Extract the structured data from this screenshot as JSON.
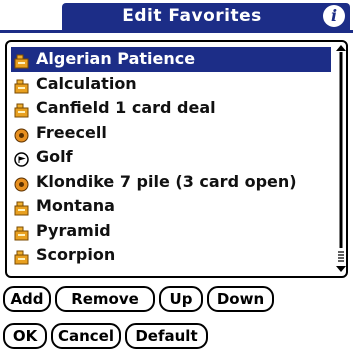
{
  "title": "Edit Favorites",
  "info_glyph": "i",
  "accent_color": "#1c2d87",
  "favorites": [
    {
      "label": "Algerian Patience",
      "icon": "briefcase-icon",
      "selected": true
    },
    {
      "label": "Calculation",
      "icon": "briefcase-icon",
      "selected": false
    },
    {
      "label": "Canfield 1 card deal",
      "icon": "briefcase-icon",
      "selected": false
    },
    {
      "label": "Freecell",
      "icon": "orange-ball-icon",
      "selected": false
    },
    {
      "label": "Golf",
      "icon": "golf-icon",
      "selected": false
    },
    {
      "label": "Klondike 7 pile (3 card open)",
      "icon": "orange-ball-icon",
      "selected": false
    },
    {
      "label": "Montana",
      "icon": "briefcase-icon",
      "selected": false
    },
    {
      "label": "Pyramid",
      "icon": "briefcase-icon",
      "selected": false
    },
    {
      "label": "Scorpion",
      "icon": "briefcase-icon",
      "selected": false
    }
  ],
  "buttons": {
    "add": "Add",
    "remove": "Remove",
    "up": "Up",
    "down": "Down",
    "ok": "OK",
    "cancel": "Cancel",
    "default": "Default"
  }
}
